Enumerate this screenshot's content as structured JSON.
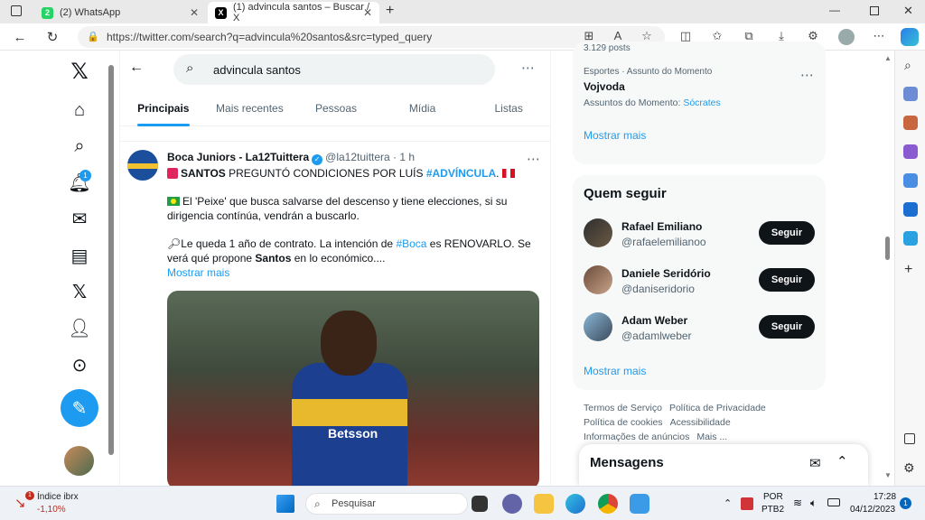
{
  "browser": {
    "tabs": [
      {
        "label": "(2) WhatsApp",
        "badge": "2"
      },
      {
        "label": "(1) advincula santos – Buscar / X"
      }
    ],
    "url": "https://twitter.com/search?q=advincula%20santos&src=typed_query"
  },
  "search": {
    "query": "advincula santos",
    "tabs": [
      "Principais",
      "Mais recentes",
      "Pessoas",
      "Mídia",
      "Listas"
    ]
  },
  "nav": {
    "notification_badge": "1"
  },
  "tweet": {
    "author": "Boca Juniors - La12Tuittera",
    "handle": "@la12tuittera",
    "time": "1 h",
    "line1_a": "SANTOS",
    "line1_b": " PREGUNTÓ CONDICIONES POR LUÍS ",
    "line1_tag": "#ADVÍNCULA",
    "line2": "El 'Peixe' que busca salvarse del descenso y tiene elecciones, si su dirigencia contínúa, vendrán a buscarlo.",
    "line3_a": "Le queda 1 año de contrato. La intención de ",
    "line3_tag": "#Boca",
    "line3_b": " es RENOVARLO. Se verá qué propone ",
    "line3_bold": "Santos",
    "line3_c": " en lo económico....",
    "show_more": "Mostrar mais",
    "image_sponsor": "Betsson"
  },
  "trends": {
    "posts_count": "3.129 posts",
    "category": "Esportes · Assunto do Momento",
    "name": "Vojvoda",
    "related_label": "Assuntos do Momento:",
    "related_link": "Sócrates",
    "show_more": "Mostrar mais"
  },
  "who_to_follow": {
    "title": "Quem seguir",
    "users": [
      {
        "name": "Rafael Emiliano",
        "handle": "@rafaelemilianoo",
        "button": "Seguir"
      },
      {
        "name": "Daniele Seridório",
        "handle": "@daniseridorio",
        "button": "Seguir"
      },
      {
        "name": "Adam Weber",
        "handle": "@adamlweber",
        "button": "Seguir"
      }
    ],
    "show_more": "Mostrar mais"
  },
  "footer": {
    "links": [
      "Termos de Serviço",
      "Política de Privacidade",
      "Política de cookies",
      "Acessibilidade",
      "Informações de anúncios",
      "Mais ..."
    ]
  },
  "messages": {
    "title": "Mensagens"
  },
  "taskbar": {
    "stock_name": "Índice ibrx",
    "stock_change": "-1,10%",
    "stock_badge": "1",
    "search_placeholder": "Pesquisar",
    "lang": "POR",
    "lang2": "PTB2",
    "time": "17:28",
    "date": "04/12/2023",
    "notif": "1"
  },
  "colors": {
    "accent": "#1d9bf0",
    "text": "#0f1419",
    "muted": "#536471"
  }
}
